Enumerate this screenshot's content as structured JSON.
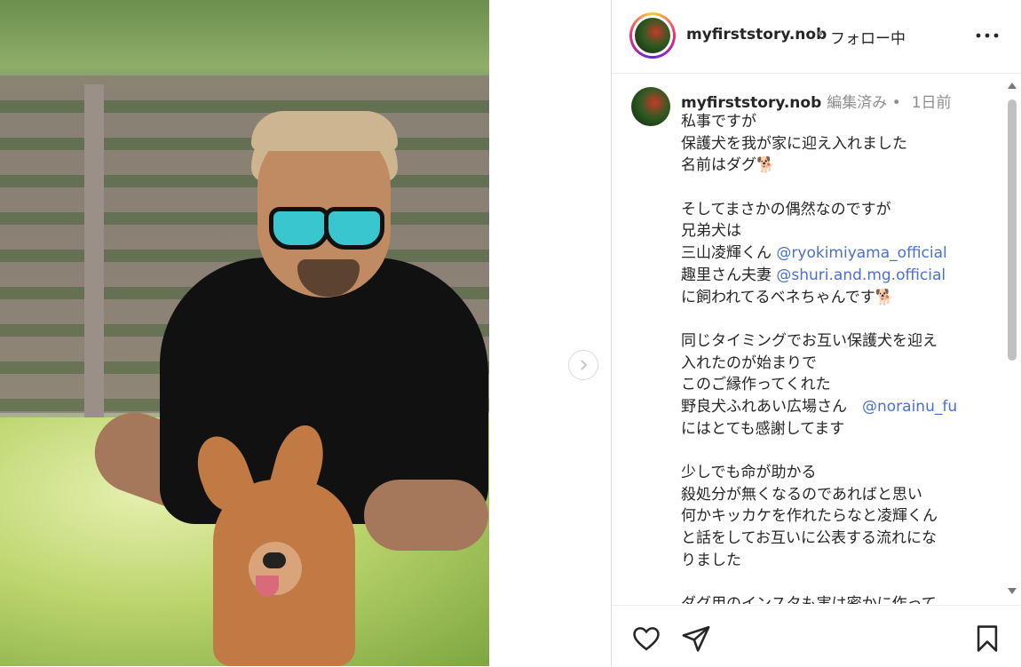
{
  "header": {
    "username": "myfirststory.nob",
    "separator": "•",
    "follow_status": "フォロー中",
    "more_label": "•••"
  },
  "caption": {
    "username": "myfirststory.nob",
    "edited": "編集済み •",
    "time": "1日前",
    "lines": [
      {
        "text": "私事ですが"
      },
      {
        "text": "保護犬を我が家に迎え入れました"
      },
      {
        "text": "名前はダグ",
        "emoji": "🐕"
      },
      {
        "text": ""
      },
      {
        "text": "そしてまさかの偶然なのですが"
      },
      {
        "text": "兄弟犬は"
      },
      {
        "text": "三山凌輝くん ",
        "mention": "@ryokimiyama_official"
      },
      {
        "text": "趣里さん夫妻 ",
        "mention": "@shuri.and.mg.official"
      },
      {
        "text": "に飼われてるベネちゃんです",
        "emoji": "🐕"
      },
      {
        "text": ""
      },
      {
        "text": "同じタイミングでお互い保護犬を迎え"
      },
      {
        "text": "入れたのが始まりで"
      },
      {
        "text": "このご縁作ってくれた"
      },
      {
        "text": "野良犬ふれあい広場さん　",
        "mention": "@norainu_fu"
      },
      {
        "text": "にはとても感謝してます"
      },
      {
        "text": ""
      },
      {
        "text": "少しでも命が助かる"
      },
      {
        "text": "殺処分が無くなるのであればと思い"
      },
      {
        "text": "何かキッカケを作れたらなと凌輝くん"
      },
      {
        "text": "と話をしてお互いに公表する流れにな"
      },
      {
        "text": "りました"
      },
      {
        "text": ""
      },
      {
        "text": "ダグ用のインスタも実は密かに作って"
      }
    ]
  },
  "icons": {
    "next": "chevron-right-icon",
    "like": "heart-icon",
    "share": "paper-plane-icon",
    "save": "bookmark-icon",
    "more": "more-horizontal-icon"
  },
  "colors": {
    "mention": "#4a6fd6",
    "text": "#262626",
    "muted": "#8e8e8e"
  }
}
